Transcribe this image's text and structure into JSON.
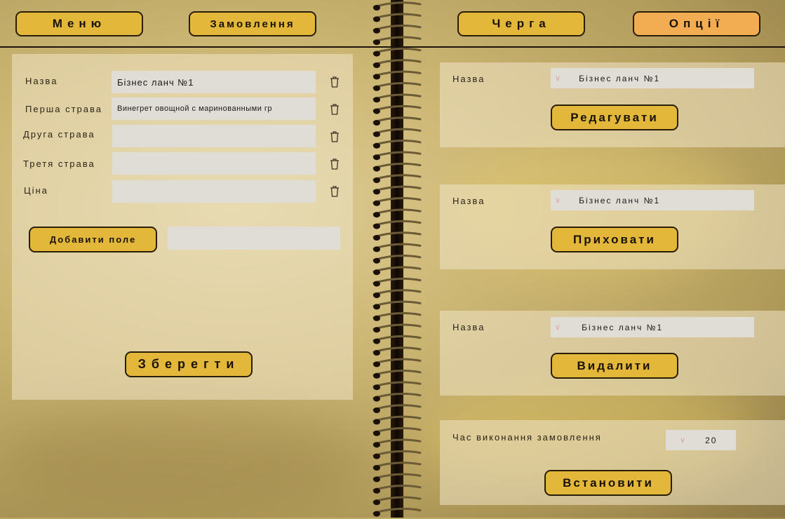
{
  "nav": {
    "menu": "Меню",
    "orders": "Замовлення",
    "queue": "Черга",
    "options": "Опції"
  },
  "form": {
    "rows": [
      {
        "label": "Назва",
        "value": "Бізнес ланч №1"
      },
      {
        "label": "Перша страва",
        "value": "Винегрет овощной с маринованными гр"
      },
      {
        "label": "Друга страва",
        "value": ""
      },
      {
        "label": "Третя страва",
        "value": ""
      },
      {
        "label": "Ціна",
        "value": ""
      }
    ],
    "add_field_label": "Добавити поле",
    "add_field_value": "",
    "save_label": "Зберегти"
  },
  "options": {
    "edit": {
      "label": "Назва",
      "selected": "Бізнес ланч №1",
      "button": "Редагувати"
    },
    "hide": {
      "label": "Назва",
      "selected": "Бізнес ланч №1",
      "button": "Приховати"
    },
    "delete": {
      "label": "Назва",
      "selected": "Бізнес ланч №1",
      "button": "Видалити"
    },
    "time": {
      "label": "Час виконання замовлення",
      "selected": "20",
      "button": "Встановити"
    }
  },
  "icons": {
    "trash": "trash-icon",
    "dropdown": "chevron-down-icon"
  },
  "colors": {
    "button": "#e3b83a",
    "active_button": "#f2ad52",
    "field": "#e0dcd6"
  }
}
